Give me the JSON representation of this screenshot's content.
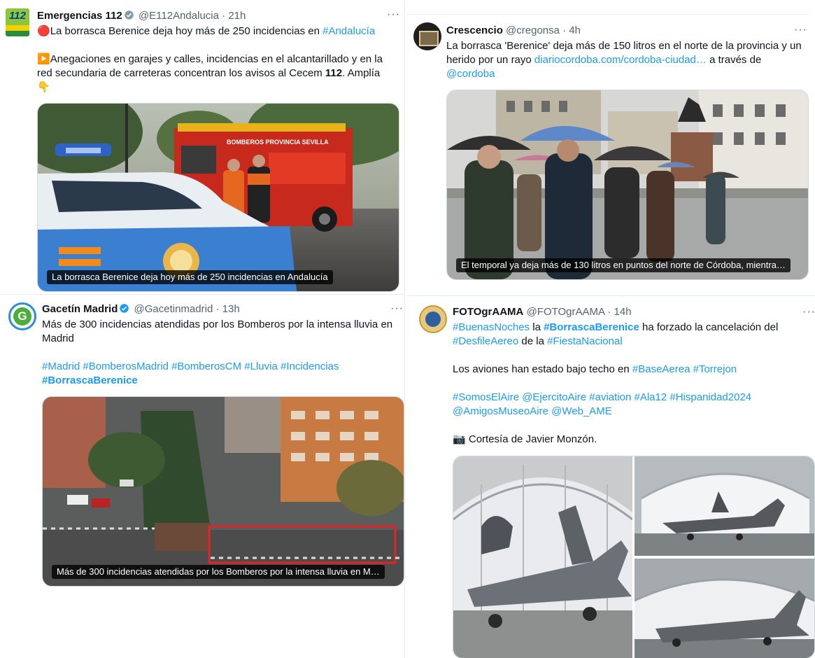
{
  "tweet1": {
    "name": "Emergencias 112",
    "handle": "@E112Andalucia",
    "sep": "·",
    "time": "21h",
    "more": "···",
    "avatar_text": "112",
    "l1_icon": "🔴",
    "l1_text": "La borrasca Berenice deja hoy más de 250 incidencias en ",
    "l1_link": "#Andalucía",
    "l2_icon": "▶️",
    "l2_text": "Anegaciones en garajes y calles, incidencias en el alcantarillado y en la",
    "l3_text": "red secundaria de carreteras concentran los avisos al Cecem ",
    "l3_bold": "112",
    "l3_end": ". Amplía",
    "l4_icon": "👇",
    "caption": "La borrasca Berenice deja hoy más de 250 incidencias en Andalucía",
    "truck_text": "BOMBEROS PROVINCIA SEVILLA"
  },
  "tweet2": {
    "name": "Crescencio",
    "handle": "@cregonsa",
    "sep": "·",
    "time": "4h",
    "more": "···",
    "l1_text": "La borrasca 'Berenice' deja más de 150 litros en el norte de la provincia y un",
    "l2_text": "herido por un rayo  ",
    "l2_link": "diariocordoba.com/cordoba-ciudad…",
    "l2_end": " a través de",
    "l3_link": "@cordoba",
    "caption": "El temporal ya deja más de 130 litros en puntos del norte de Córdoba, mientra…"
  },
  "tweet3": {
    "name": "Gacetín Madrid",
    "handle": "@Gacetinmadrid",
    "sep": "·",
    "time": "13h",
    "more": "···",
    "avatar_text": "G",
    "l1_text": "Más de 300 incidencias atendidas por los Bomberos por la intensa lluvia en",
    "l2_text": "Madrid",
    "l3_link": "#Madrid #BomberosMadrid #BomberosCM #Lluvia #Incidencias",
    "l4_link": "#BorrascaBerenice",
    "caption": "Más de 300 incidencias atendidas por los Bomberos por la intensa lluvia en M…"
  },
  "tweet4": {
    "name": "FOTOgrAAMA",
    "handle": "@FOTOgrAAMA",
    "sep": "·",
    "time": "14h",
    "more": "···",
    "l1_link1": "#BuenasNoches",
    "l1_text1": " la ",
    "l1_link2": "#BorrascaBerenice",
    "l1_text2": " ha forzado la cancelación del",
    "l2_link1": "#DesfileAereo",
    "l2_text1": " de la ",
    "l2_link2": "#FiestaNacional",
    "l3_text": "Los aviones han estado bajo techo en ",
    "l3_link1": "#BaseAerea",
    "l3_link2": "#Torrejon",
    "l4_link": "#SomosElAire @EjercitoAire #aviation #Ala12 #Hispanidad2024",
    "l5_link": "@AmigosMuseoAire @Web_AME",
    "l6_icon": "📷",
    "l6_text": " Cortesía de Javier Monzón."
  }
}
